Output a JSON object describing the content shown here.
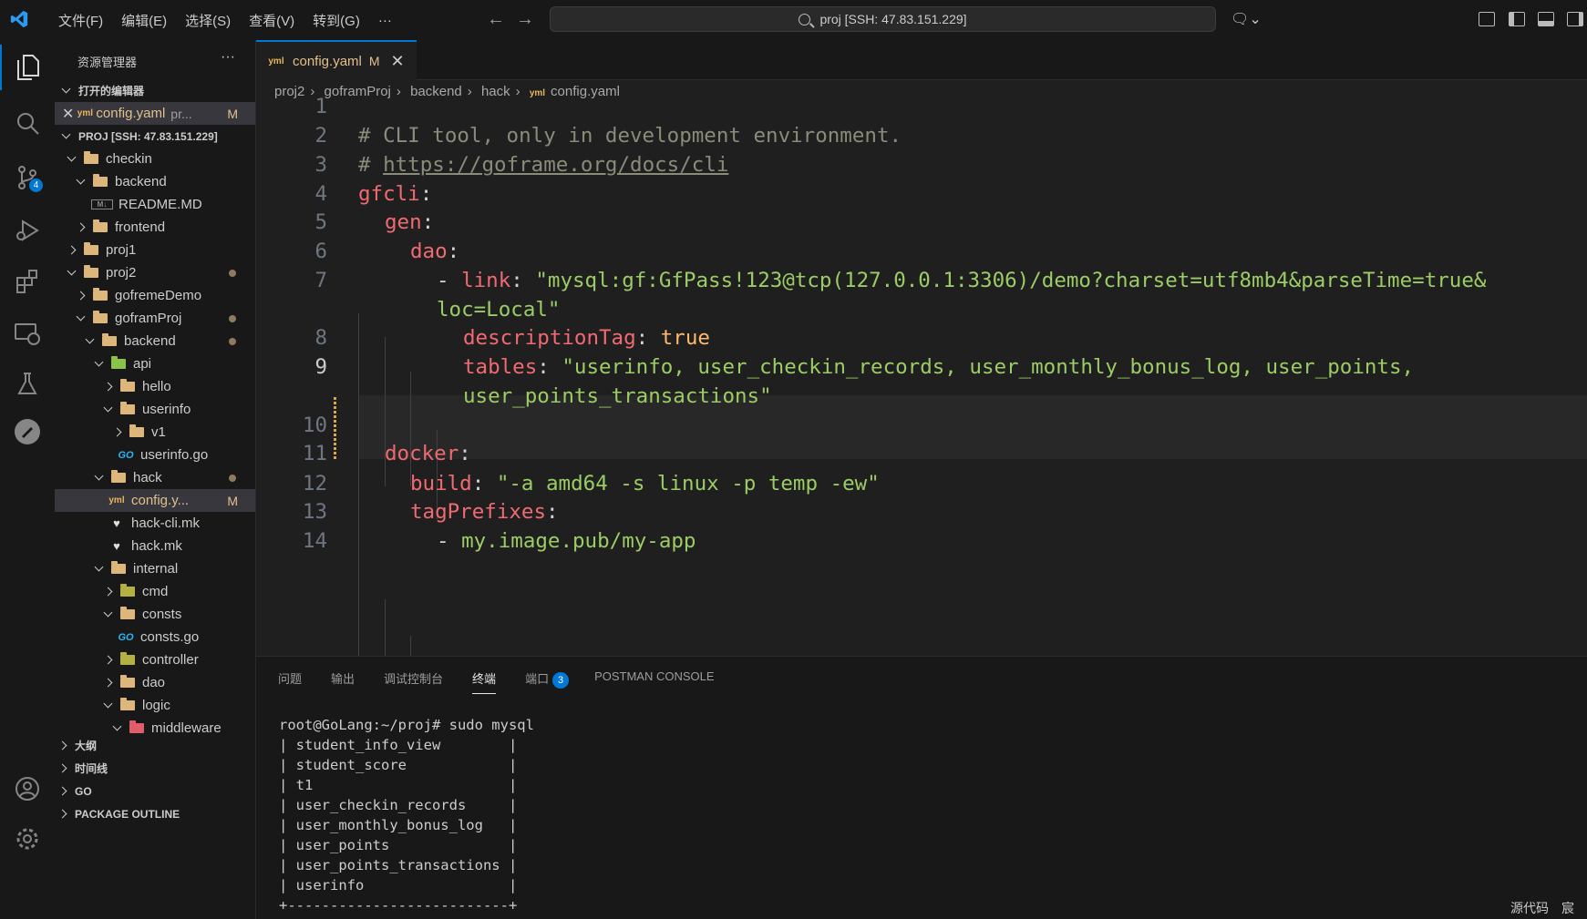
{
  "menu": [
    "文件(F)",
    "编辑(E)",
    "选择(S)",
    "查看(V)",
    "转到(G)",
    "···"
  ],
  "command_center": "proj [SSH: 47.83.151.229]",
  "activity": {
    "scm_badge": "4"
  },
  "sidebar": {
    "title": "资源管理器",
    "open_editors_label": "打开的编辑器",
    "open_editor": {
      "name": "config.yaml",
      "dir": "pr...",
      "status": "M"
    },
    "workspace_label": "PROJ [SSH: 47.83.151.229]",
    "tree": [
      "checkin",
      "backend",
      "README.MD",
      "frontend",
      "proj1",
      "proj2",
      "gofremeDemo",
      "goframProj",
      "backend",
      "api",
      "hello",
      "userinfo",
      "v1",
      "userinfo.go",
      "hack",
      "config.y...",
      "hack-cli.mk",
      "hack.mk",
      "internal",
      "cmd",
      "consts",
      "consts.go",
      "controller",
      "dao",
      "logic",
      "middleware"
    ],
    "modified_marker": "M",
    "bottom_sections": [
      "大纲",
      "时间线",
      "GO",
      "PACKAGE OUTLINE"
    ]
  },
  "tab": {
    "label": "config.yaml",
    "status": "M"
  },
  "breadcrumb": [
    "proj2",
    "goframProj",
    "backend",
    "hack",
    "config.yaml"
  ],
  "editor": {
    "line_numbers": [
      "1",
      "2",
      "3",
      "4",
      "5",
      "6",
      "7",
      "8",
      "9",
      "10",
      "11",
      "12",
      "13",
      "14"
    ],
    "code": {
      "l2": "# CLI tool, only in development environment.",
      "l3_hash": "# ",
      "l3_link": "https://goframe.org/docs/cli",
      "l4_key": "gfcli",
      "l5_key": "gen",
      "l6_key": "dao",
      "l7_dash": "- ",
      "l7_key": "link",
      "l7_val": "\"mysql:gf:GfPass!123@tcp(127.0.0.1:3306)/demo?charset=utf8mb4&parseTime=true&",
      "l7_cont": "loc=Local\"",
      "l8_key": "descriptionTag",
      "l8_val": "true",
      "l9_key": "tables",
      "l9_val": "\"userinfo, user_checkin_records, user_monthly_bonus_log, user_points,",
      "l9_cont": "user_points_transactions\"",
      "l11_key": "docker",
      "l12_key": "build",
      "l12_val": "\"-a amd64 -s linux -p temp -ew\"",
      "l13_key": "tagPrefixes",
      "l14_dash": "- ",
      "l14_val": "my.image.pub/my-app",
      "colon": ":"
    }
  },
  "panel": {
    "tabs": [
      "问题",
      "输出",
      "调试控制台",
      "终端",
      "端口",
      "POSTMAN CONSOLE"
    ],
    "ports_badge": "3",
    "terminal": [
      "root@GoLang:~/proj# sudo mysql",
      "| student_info_view        |",
      "| student_score            |",
      "| t1                       |",
      "| user_checkin_records     |",
      "| user_monthly_bonus_log   |",
      "| user_points              |",
      "| user_points_transactions |",
      "| userinfo                 |",
      "+--------------------------+"
    ],
    "status_right": "源代码　宸"
  }
}
